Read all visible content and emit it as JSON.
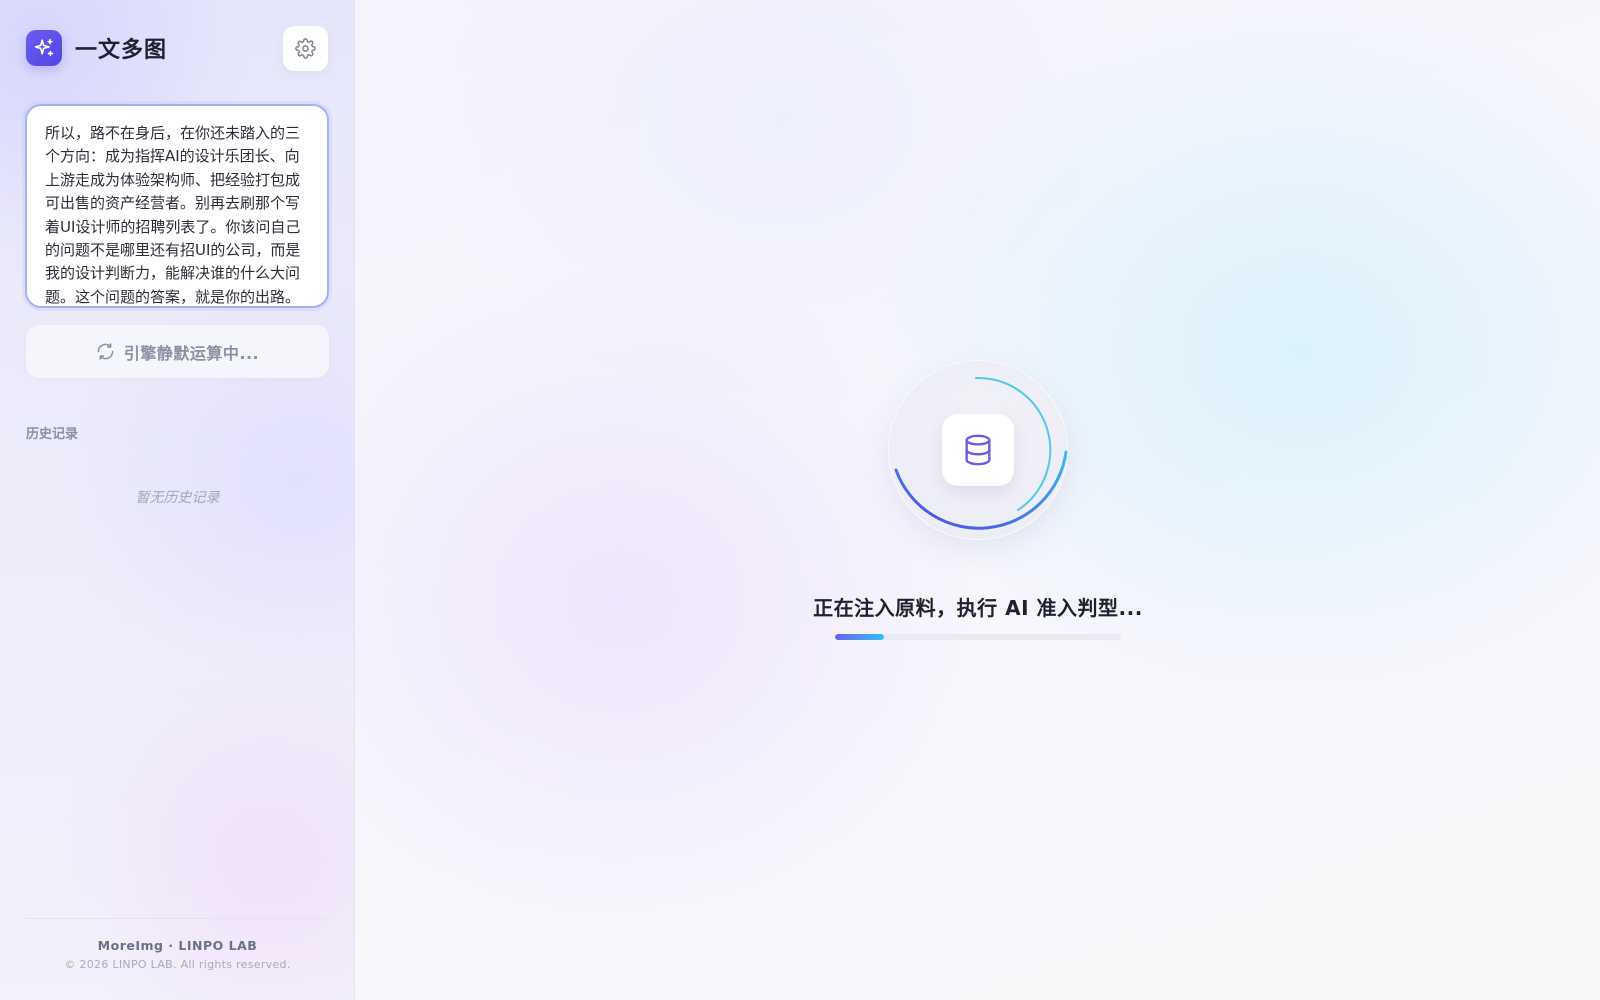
{
  "app": {
    "title": "一文多图"
  },
  "sidebar": {
    "prompt_text": "所以，路不在身后，在你还未踏入的三个方向：成为指挥AI的设计乐团长、向上游走成为体验架构师、把经验打包成可出售的资产经营者。别再去刷那个写着UI设计师的招聘列表了。你该问自己的问题不是哪里还有招UI的公司，而是我的设计判断力，能解决谁的什么大问题。这个问题的答案，就是你的出路。",
    "run_button_label": "引擎静默运算中...",
    "history_title": "历史记录",
    "history_empty": "暂无历史记录",
    "footer_brand": "MoreImg · LINPO LAB",
    "footer_copyright": "© 2026 LINPO LAB. All rights reserved."
  },
  "main": {
    "status_text": "正在注入原料，执行 AI 准入判型...",
    "progress_percent": 17
  },
  "icons": {
    "brand": "sparkles-icon",
    "settings": "gear-icon",
    "run": "refresh-icon",
    "loader": "database-icon"
  },
  "colors": {
    "accent": "#4f46e5",
    "accent_light": "#38bdf8",
    "prompt_border": "#a3b3f5"
  }
}
